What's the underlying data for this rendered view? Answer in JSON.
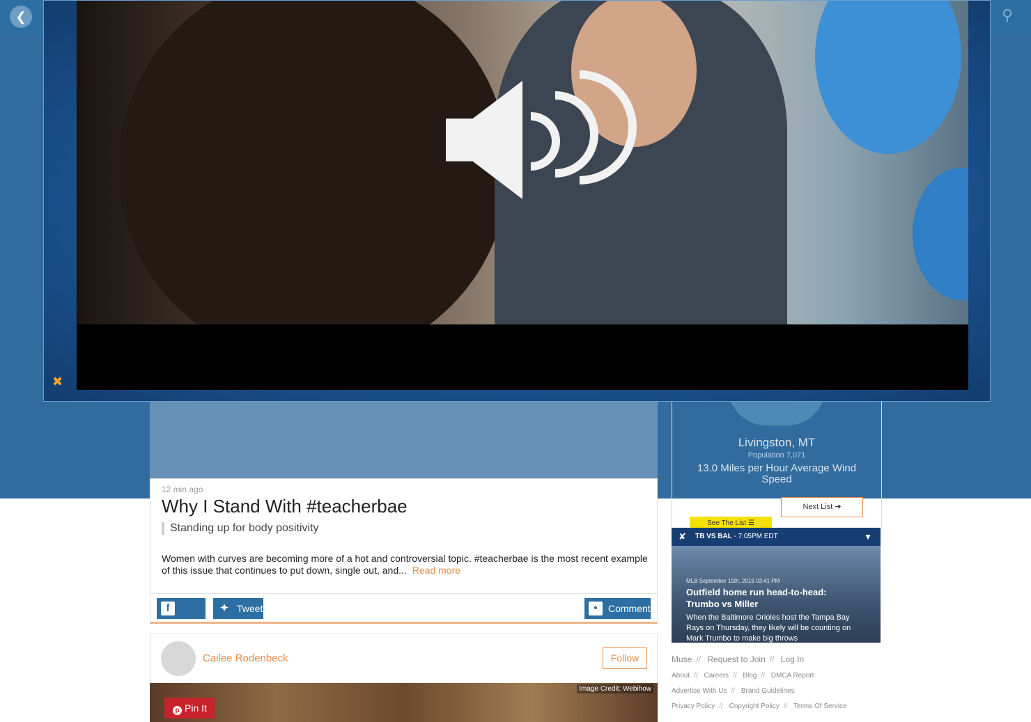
{
  "article": {
    "time": "12 min ago",
    "title": "Why I Stand With #teacherbae",
    "subtitle": "Standing up for body positivity",
    "excerpt": "Women with curves are becoming more of a hot and controversial topic. #teacherbae is the most recent example of this issue that continues to put down, single out, and...",
    "read_more": "Read more",
    "share": "Share",
    "tweet": "Tweet",
    "comment": "Comment"
  },
  "author": {
    "name": "Cailee Rodenbeck",
    "follow": "Follow"
  },
  "image": {
    "credit": "Image Credit: Webihow",
    "pin": "Pin It"
  },
  "sidebar": {
    "city": "Livingston, MT",
    "population": "Population 7,071",
    "wind": "13.0 Miles per Hour Average Wind Speed",
    "next_list": "Next List",
    "see_list": "See The List"
  },
  "score": {
    "game": "TB VS BAL",
    "time": "- 7:05PM EDT",
    "meta": "MLB September 15th, 2016 03:41 PM",
    "title": "Outfield home run head-to-head: Trumbo vs Miller",
    "text": "When the Baltimore Orioles host the Tampa Bay Rays on Thursday, they likely will be counting on Mark Trumbo to make big throws"
  },
  "footer": {
    "row1": [
      "Muse",
      "Request to Join",
      "Log In"
    ],
    "row2": [
      "About",
      "Careers",
      "Blog",
      "DMCA Report"
    ],
    "row3": [
      "Advertise With Us",
      "Brand Guidelines"
    ],
    "row4": [
      "Privacy Policy",
      "Copyright Policy",
      "Terms Of Service"
    ],
    "separator": "//"
  },
  "colors": {
    "brand_blue": "#2d6fa3",
    "accent_orange": "#e88b45",
    "pin_red": "#c8232c"
  }
}
